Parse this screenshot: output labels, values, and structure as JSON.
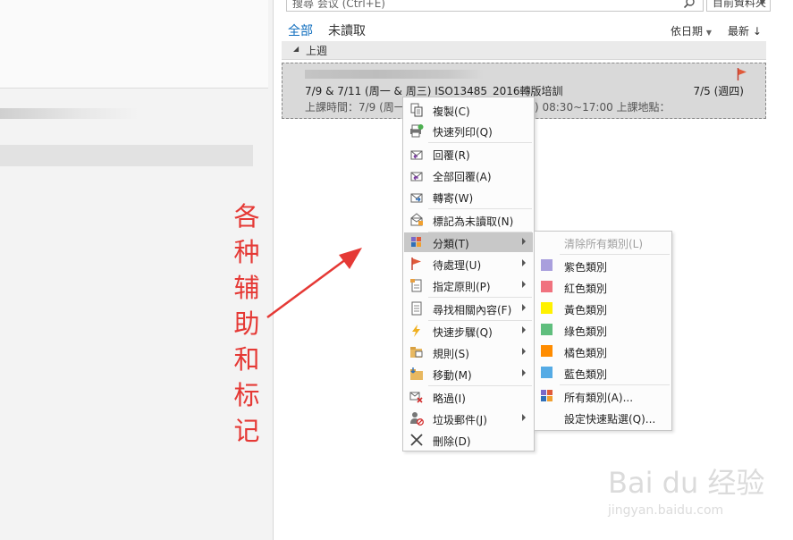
{
  "search": {
    "placeholder": "搜尋 会议 (Ctrl+E)",
    "scope": "目前資料夾"
  },
  "filters": {
    "all": "全部",
    "unread": "未讀取",
    "sort_by": "依日期",
    "order": "最新"
  },
  "group": {
    "label": "上週"
  },
  "message": {
    "subject": "7/9 & 7/11 (周一 & 周三) ISO13485_2016轉版培訓",
    "date": "7/5 (週四)",
    "preview": "上課時間：7/9 (周一",
    "preview_end": ") 08:30~17:00  上課地點："
  },
  "context_menu": {
    "items": [
      {
        "label": "複製(C)",
        "icon": "copy-icon"
      },
      {
        "label": "快速列印(Q)",
        "icon": "print-icon"
      },
      {
        "label": "回覆(R)",
        "icon": "reply-icon"
      },
      {
        "label": "全部回覆(A)",
        "icon": "reply-all-icon"
      },
      {
        "label": "轉寄(W)",
        "icon": "forward-icon"
      },
      {
        "label": "標記為未讀取(N)",
        "icon": "mark-unread-icon"
      },
      {
        "label": "分類(T)",
        "icon": "categorize-icon"
      },
      {
        "label": "待處理(U)",
        "icon": "flag-icon"
      },
      {
        "label": "指定原則(P)",
        "icon": "policy-icon"
      },
      {
        "label": "尋找相關內容(F)",
        "icon": "find-related-icon"
      },
      {
        "label": "快速步驟(Q)",
        "icon": "quick-steps-icon"
      },
      {
        "label": "規則(S)",
        "icon": "rules-icon"
      },
      {
        "label": "移動(M)",
        "icon": "move-icon"
      },
      {
        "label": "略過(I)",
        "icon": "ignore-icon"
      },
      {
        "label": "垃圾郵件(J)",
        "icon": "junk-icon"
      },
      {
        "label": "刪除(D)",
        "icon": "delete-icon"
      }
    ]
  },
  "category_submenu": {
    "clear": "清除所有類別(L)",
    "categories": [
      {
        "label": "紫色類別",
        "color": "#a99fdd"
      },
      {
        "label": "紅色類別",
        "color": "#f0727e"
      },
      {
        "label": "黃色類別",
        "color": "#fff100"
      },
      {
        "label": "綠色類別",
        "color": "#5fbe7d"
      },
      {
        "label": "橘色類別",
        "color": "#ff8c00"
      },
      {
        "label": "藍色類別",
        "color": "#55abe5"
      }
    ],
    "all": "所有類別(A)...",
    "quick_click": "設定快速點選(Q)..."
  },
  "annotation": {
    "chars": [
      "各",
      "种",
      "辅",
      "助",
      "和",
      "标",
      "记"
    ],
    "color": "#e53935"
  },
  "watermark": {
    "brand": "Bai du 经验",
    "url": "jingyan.baidu.com"
  }
}
